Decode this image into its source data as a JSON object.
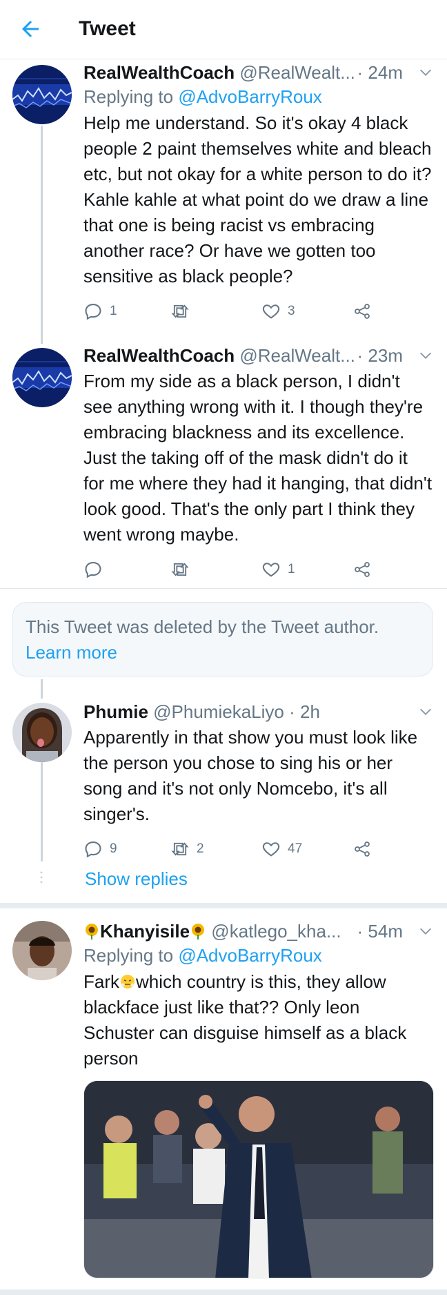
{
  "header": {
    "title": "Tweet"
  },
  "tweets": [
    {
      "name": "RealWealthCoach",
      "handle": "@RealWealt...",
      "time": "· 24m",
      "replying_prefix": "Replying to ",
      "replying_to": "@AdvoBarryRoux",
      "body": "Help me understand. So it's okay 4 black people 2 paint themselves white and bleach etc, but not okay for a white person to do it? Kahle kahle at what point do we draw a line that one is being racist vs embracing another race? Or have we gotten too sensitive as black people?",
      "replies": "1",
      "retweets": "",
      "likes": "3"
    },
    {
      "name": "RealWealthCoach",
      "handle": "@RealWealt...",
      "time": "· 23m",
      "body": "From my side as a black person, I didn't see anything wrong with it. I though they're embracing blackness and its excellence. Just the taking off of the mask didn't do it for me where they had it hanging, that didn't look good. That's the only part I think they went wrong maybe.",
      "replies": "",
      "retweets": "",
      "likes": "1"
    },
    {
      "name": "Phumie",
      "handle": "@PhumiekaLiyo",
      "time": "· 2h",
      "body": "Apparently in that show you must look like the person you chose to sing his or her song and it's not only Nomcebo, it's all singer's.",
      "replies": "9",
      "retweets": "2",
      "likes": "47"
    },
    {
      "name": "Khanyisile",
      "handle": "@katlego_kha...",
      "time": "· 54m",
      "replying_prefix": "Replying to ",
      "replying_to": "@AdvoBarryRoux",
      "body_before_emoji": "Fark",
      "body": "which country is this, they allow blackface just like that?? Only leon Schuster can disguise himself as a black person"
    }
  ],
  "deleted_notice": {
    "text": "This Tweet was deleted by the Tweet author.",
    "link": "Learn more"
  },
  "show_replies": "Show replies",
  "colors": {
    "accent": "#1da1f2",
    "secondary_text": "#657786",
    "border": "#e1e8ed"
  },
  "icons": [
    "back-arrow-icon",
    "chevron-down-icon",
    "reply-icon",
    "retweet-icon",
    "like-icon",
    "share-icon",
    "sunflower-emoji",
    "steam-face-emoji"
  ]
}
